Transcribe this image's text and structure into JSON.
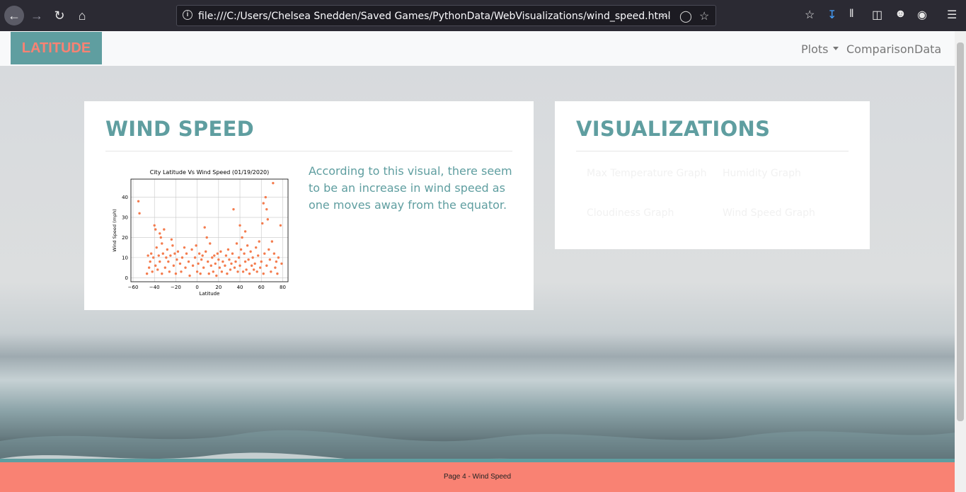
{
  "browser": {
    "url": "file:///C:/Users/Chelsea Snedden/Saved Games/PythonData/WebVisualizations/wind_speed.html"
  },
  "nav": {
    "brand": "LATITUDE",
    "links": [
      {
        "label": "Plots",
        "dropdown": true
      },
      {
        "label": "Comparison"
      },
      {
        "label": "Data"
      }
    ]
  },
  "main_card": {
    "title": "WIND SPEED",
    "description": "According to this visual, there seem to be an increase in wind speed as one moves away from the equator."
  },
  "vis_card": {
    "title": "VISUALIZATIONS",
    "links": [
      "Max Temperature Graph",
      "Humidity Graph",
      "Cloudiness Graph",
      "Wind Speed Graph"
    ]
  },
  "footer": {
    "text": "Page 4 - Wind Speed"
  },
  "colors": {
    "accent": "#5f9ea0",
    "brand_text": "#f98273",
    "footer_bg": "#f98273",
    "marker": "#f47c4e"
  },
  "chart_data": {
    "type": "scatter",
    "title": "City Latitude Vs Wind Speed (01/19/2020)",
    "xlabel": "Latitude",
    "ylabel": "Wind Speed (mph)",
    "xlim": [
      -62,
      85
    ],
    "ylim": [
      -2,
      49
    ],
    "xticks": [
      -60,
      -40,
      -20,
      0,
      20,
      40,
      60,
      80
    ],
    "yticks": [
      0,
      10,
      20,
      30,
      40
    ],
    "grid": true,
    "points": [
      [
        -55,
        38
      ],
      [
        -54,
        32
      ],
      [
        -47,
        2
      ],
      [
        -46,
        11
      ],
      [
        -45,
        5
      ],
      [
        -44,
        8
      ],
      [
        -43,
        12
      ],
      [
        -42,
        3
      ],
      [
        -41,
        10
      ],
      [
        -40,
        26
      ],
      [
        -39,
        24
      ],
      [
        -39,
        6
      ],
      [
        -38,
        15
      ],
      [
        -37,
        4
      ],
      [
        -36,
        11
      ],
      [
        -35,
        22
      ],
      [
        -35,
        8
      ],
      [
        -34,
        20
      ],
      [
        -33,
        17
      ],
      [
        -33,
        2
      ],
      [
        -32,
        12
      ],
      [
        -31,
        24
      ],
      [
        -30,
        5
      ],
      [
        -29,
        10
      ],
      [
        -28,
        14
      ],
      [
        -27,
        8
      ],
      [
        -26,
        3
      ],
      [
        -25,
        11
      ],
      [
        -24,
        19
      ],
      [
        -23,
        16
      ],
      [
        -22,
        6
      ],
      [
        -21,
        12
      ],
      [
        -20,
        2
      ],
      [
        -19,
        9
      ],
      [
        -18,
        13
      ],
      [
        -16,
        7
      ],
      [
        -15,
        3
      ],
      [
        -14,
        10
      ],
      [
        -12,
        15
      ],
      [
        -11,
        5
      ],
      [
        -10,
        12
      ],
      [
        -8,
        8
      ],
      [
        -7,
        1
      ],
      [
        -5,
        14
      ],
      [
        -4,
        6
      ],
      [
        -2,
        10
      ],
      [
        -1,
        16
      ],
      [
        0,
        3
      ],
      [
        1,
        7
      ],
      [
        2,
        12
      ],
      [
        3,
        2
      ],
      [
        4,
        9
      ],
      [
        5,
        11
      ],
      [
        6,
        5
      ],
      [
        7,
        25
      ],
      [
        8,
        13
      ],
      [
        9,
        20
      ],
      [
        10,
        8
      ],
      [
        11,
        2
      ],
      [
        12,
        17
      ],
      [
        13,
        6
      ],
      [
        14,
        10
      ],
      [
        15,
        3
      ],
      [
        16,
        11
      ],
      [
        17,
        7
      ],
      [
        18,
        1
      ],
      [
        19,
        12
      ],
      [
        20,
        9
      ],
      [
        21,
        5
      ],
      [
        22,
        13
      ],
      [
        23,
        3
      ],
      [
        24,
        8
      ],
      [
        26,
        6
      ],
      [
        27,
        11
      ],
      [
        28,
        2
      ],
      [
        29,
        14
      ],
      [
        30,
        9
      ],
      [
        31,
        4
      ],
      [
        32,
        7
      ],
      [
        33,
        12
      ],
      [
        34,
        34
      ],
      [
        35,
        5
      ],
      [
        36,
        8
      ],
      [
        37,
        17
      ],
      [
        38,
        3
      ],
      [
        39,
        10
      ],
      [
        40,
        26
      ],
      [
        40,
        6
      ],
      [
        41,
        14
      ],
      [
        42,
        20
      ],
      [
        43,
        3
      ],
      [
        44,
        12
      ],
      [
        45,
        8
      ],
      [
        45,
        23
      ],
      [
        46,
        4
      ],
      [
        47,
        16
      ],
      [
        48,
        9
      ],
      [
        49,
        2
      ],
      [
        50,
        13
      ],
      [
        51,
        6
      ],
      [
        52,
        10
      ],
      [
        53,
        4
      ],
      [
        54,
        7
      ],
      [
        55,
        15
      ],
      [
        56,
        3
      ],
      [
        57,
        11
      ],
      [
        58,
        18
      ],
      [
        59,
        5
      ],
      [
        60,
        8
      ],
      [
        61,
        27
      ],
      [
        62,
        37
      ],
      [
        62,
        2
      ],
      [
        63,
        12
      ],
      [
        64,
        40
      ],
      [
        65,
        34
      ],
      [
        65,
        6
      ],
      [
        66,
        29
      ],
      [
        67,
        14
      ],
      [
        68,
        9
      ],
      [
        69,
        3
      ],
      [
        70,
        18
      ],
      [
        71,
        47
      ],
      [
        72,
        12
      ],
      [
        73,
        5
      ],
      [
        74,
        8
      ],
      [
        75,
        2
      ],
      [
        76,
        10
      ],
      [
        78,
        26
      ],
      [
        79,
        7
      ]
    ]
  }
}
